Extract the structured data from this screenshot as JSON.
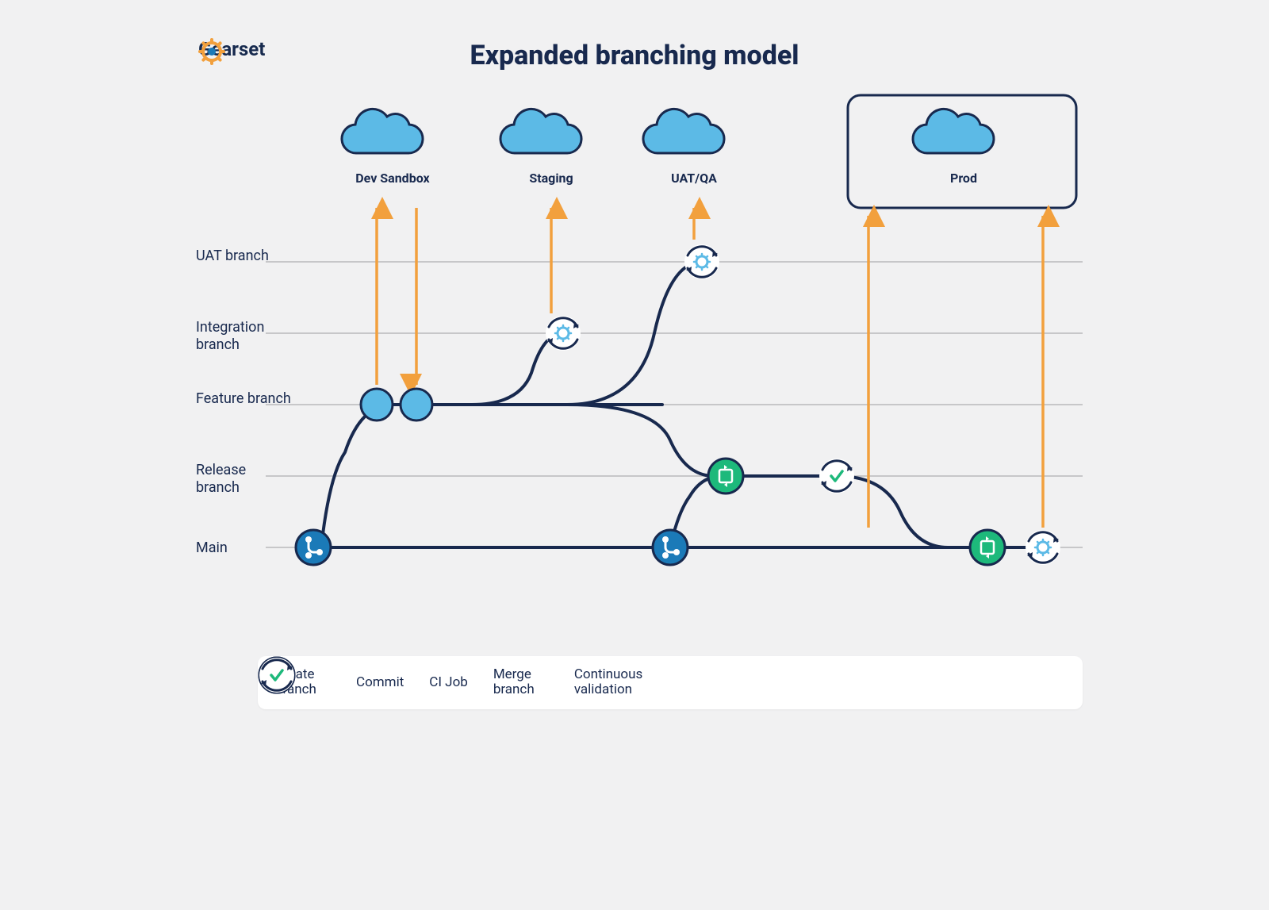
{
  "brand": "Gearset",
  "title": "Expanded branching model",
  "lanes": {
    "uat": "UAT branch",
    "integration": "Integration branch",
    "feature": "Feature branch",
    "release": "Release branch",
    "main": "Main"
  },
  "environments": {
    "dev": "Dev Sandbox",
    "staging": "Staging",
    "uatqa": "UAT/QA",
    "prod": "Prod"
  },
  "legend": {
    "create": "Create branch",
    "commit": "Commit",
    "ci": "CI Job",
    "merge": "Merge branch",
    "cv": "Continuous validation"
  },
  "colors": {
    "navy": "#18294e",
    "blue": "#1b7ab8",
    "sky": "#5cbae6",
    "green": "#1db97b",
    "orange": "#f2a03d",
    "grid": "#c7c7c9"
  }
}
